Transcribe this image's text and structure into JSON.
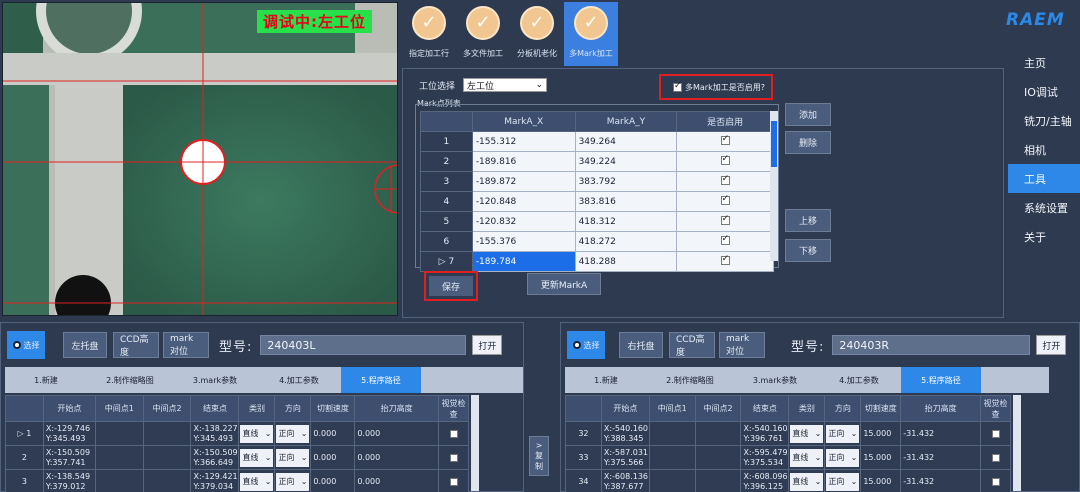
{
  "camera": {
    "status_text": "调试中:左工位"
  },
  "icon_tabs": [
    {
      "label": "指定加工行",
      "icon": "check-circle-icon",
      "active": false
    },
    {
      "label": "多文件加工",
      "icon": "check-circle-icon",
      "active": false
    },
    {
      "label": "分板机老化",
      "icon": "check-circle-icon",
      "active": false
    },
    {
      "label": "多Mark加工",
      "icon": "check-circle-icon",
      "active": true
    }
  ],
  "mark_panel": {
    "station_label": "工位选择",
    "station_value": "左工位",
    "enable_label": "多Mark加工是否启用?",
    "enable_checked": true,
    "list_legend": "Mark点列表",
    "columns": [
      "",
      "MarkA_X",
      "MarkA_Y",
      "是否启用"
    ],
    "rows": [
      {
        "index": "1",
        "x": "-155.312",
        "y": "349.264",
        "enabled": true
      },
      {
        "index": "2",
        "x": "-189.816",
        "y": "349.224",
        "enabled": true
      },
      {
        "index": "3",
        "x": "-189.872",
        "y": "383.792",
        "enabled": true
      },
      {
        "index": "4",
        "x": "-120.848",
        "y": "383.816",
        "enabled": true
      },
      {
        "index": "5",
        "x": "-120.832",
        "y": "418.312",
        "enabled": true
      },
      {
        "index": "6",
        "x": "-155.376",
        "y": "418.272",
        "enabled": true
      },
      {
        "index": "7",
        "x": "-189.784",
        "y": "418.288",
        "enabled": true,
        "selected": true
      }
    ],
    "add_label": "添加",
    "delete_label": "删除",
    "up_label": "上移",
    "down_label": "下移",
    "save_label": "保存",
    "update_label": "更新MarkA"
  },
  "brand": {
    "logo_text": "RAEM",
    "accent": "#2e88e8"
  },
  "nav": [
    {
      "label": "主页",
      "active": false
    },
    {
      "label": "IO调试",
      "active": false
    },
    {
      "label": "铣刀/主轴",
      "active": false
    },
    {
      "label": "相机",
      "active": false
    },
    {
      "label": "工具",
      "active": true
    },
    {
      "label": "系统设置",
      "active": false
    },
    {
      "label": "关于",
      "active": false
    }
  ],
  "left_station": {
    "select_label": "选择",
    "tray_label": "左托盘",
    "ccd_label": "CCD高度",
    "mark_align_label": "mark对位",
    "model_label": "型号:",
    "model_value": "240403L",
    "open_label": "打开",
    "tabs": [
      "1.新建",
      "2.制作缩略图",
      "3.mark参数",
      "4.加工参数",
      "5.程序路径"
    ],
    "active_tab": 4,
    "columns": [
      "",
      "开始点",
      "中间点1",
      "中间点2",
      "结束点",
      "类别",
      "方向",
      "切割速度",
      "抬刀高度",
      "视觉检查"
    ],
    "rows": [
      {
        "index": "1",
        "start_x": "X:-129.746",
        "start_y": "Y:345.493",
        "end_x": "X:-138.227",
        "end_y": "Y:345.493",
        "type": "直线",
        "dir": "正向",
        "speed": "0.000",
        "lift": "0.000"
      },
      {
        "index": "2",
        "start_x": "X:-150.509",
        "start_y": "Y:357.741",
        "end_x": "X:-150.509",
        "end_y": "Y:366.649",
        "type": "直线",
        "dir": "正向",
        "speed": "0.000",
        "lift": "0.000"
      },
      {
        "index": "3",
        "start_x": "X:-138.549",
        "start_y": "Y:379.012",
        "end_x": "X:-129.421",
        "end_y": "Y:379.034",
        "type": "直线",
        "dir": "正向",
        "speed": "0.000",
        "lift": "0.000"
      }
    ]
  },
  "copy_button": {
    "arrow": ">",
    "line1": "复",
    "line2": "制"
  },
  "right_station": {
    "select_label": "选择",
    "tray_label": "右托盘",
    "ccd_label": "CCD高度",
    "mark_align_label": "mark对位",
    "model_label": "型号:",
    "model_value": "240403R",
    "open_label": "打开",
    "tabs": [
      "1.新建",
      "2.制作缩略图",
      "3.mark参数",
      "4.加工参数",
      "5.程序路径"
    ],
    "active_tab": 4,
    "columns": [
      "",
      "开始点",
      "中间点1",
      "中间点2",
      "结束点",
      "类别",
      "方向",
      "切割速度",
      "抬刀高度",
      "视觉检查"
    ],
    "rows": [
      {
        "index": "32",
        "start_x": "X:-540.160",
        "start_y": "Y:388.345",
        "end_x": "X:-540.160",
        "end_y": "Y:396.761",
        "type": "直线",
        "dir": "正向",
        "speed": "15.000",
        "lift": "-31.432"
      },
      {
        "index": "33",
        "start_x": "X:-587.031",
        "start_y": "Y:375.566",
        "end_x": "X:-595.479",
        "end_y": "Y:375.534",
        "type": "直线",
        "dir": "正向",
        "speed": "15.000",
        "lift": "-31.432"
      },
      {
        "index": "34",
        "start_x": "X:-608.136",
        "start_y": "Y:387.677",
        "end_x": "X:-608.096",
        "end_y": "Y:396.125",
        "type": "直线",
        "dir": "正向",
        "speed": "15.000",
        "lift": "-31.432"
      }
    ]
  }
}
